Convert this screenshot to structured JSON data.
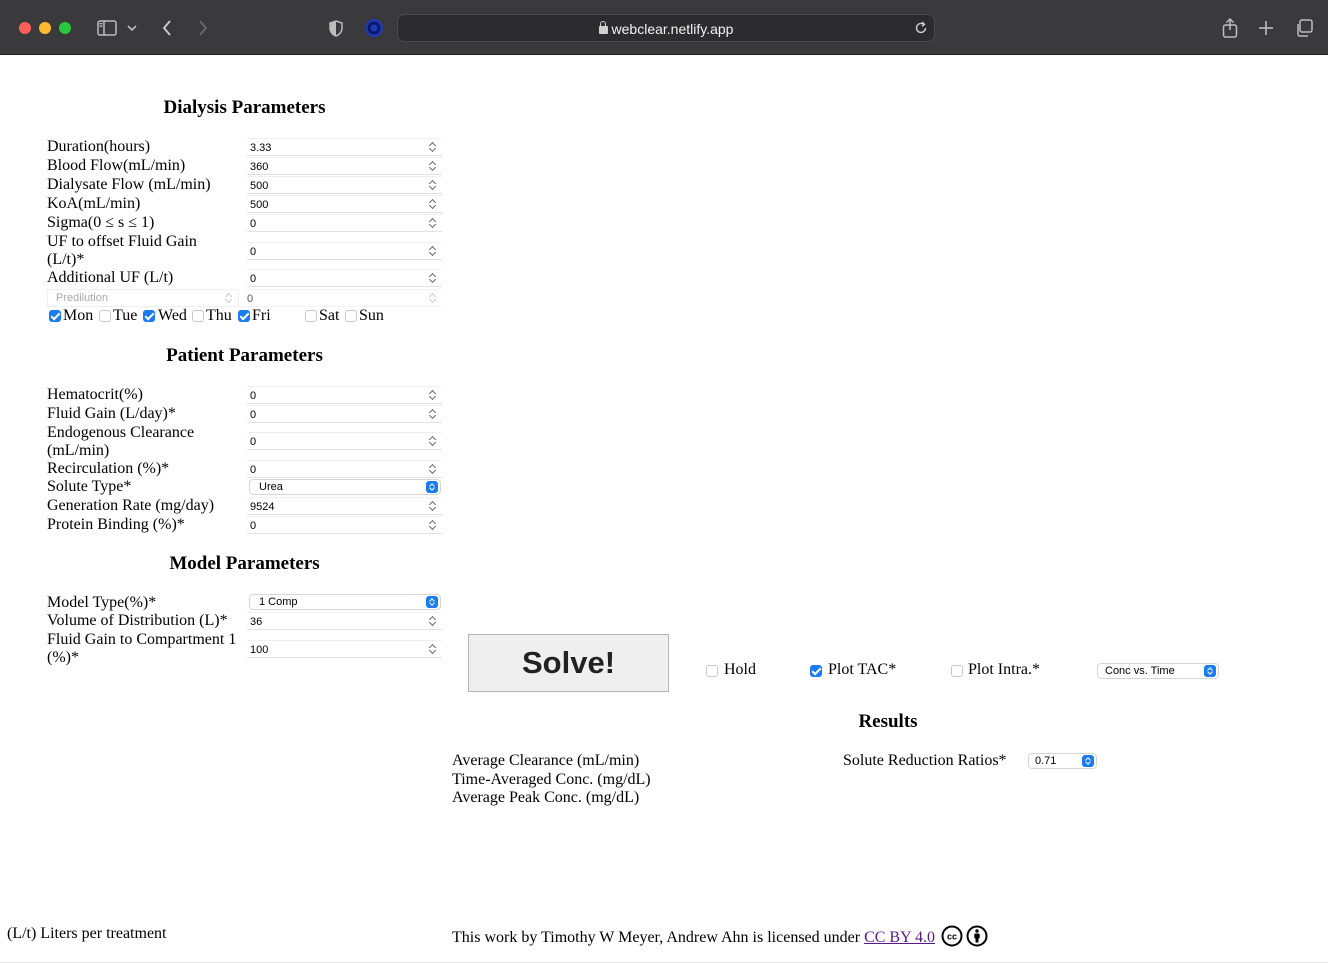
{
  "browser": {
    "url": "webclear.netlify.app"
  },
  "dialysis": {
    "title": "Dialysis Parameters",
    "fields": [
      {
        "label": "Duration(hours)",
        "value": "3.33"
      },
      {
        "label": "Blood Flow(mL/min)",
        "value": "360"
      },
      {
        "label": "Dialysate Flow (mL/min)",
        "value": "500"
      },
      {
        "label": "KoA(mL/min)",
        "value": "500"
      },
      {
        "label": "Sigma(0 ≤ s ≤ 1)",
        "value": "0"
      },
      {
        "label": "UF to offset Fluid Gain (L/t)*",
        "value": "0"
      },
      {
        "label": "Additional UF (L/t)",
        "value": "0"
      }
    ],
    "predilution": {
      "select": "Predilution",
      "value": "0"
    },
    "days": [
      {
        "label": "Mon",
        "checked": true
      },
      {
        "label": "Tue",
        "checked": false
      },
      {
        "label": "Wed",
        "checked": true
      },
      {
        "label": "Thu",
        "checked": false
      },
      {
        "label": "Fri",
        "checked": true
      },
      {
        "label": "Sat",
        "checked": false
      },
      {
        "label": "Sun",
        "checked": false
      }
    ]
  },
  "patient": {
    "title": "Patient Parameters",
    "fields": [
      {
        "label": "Hematocrit(%)",
        "value": "0"
      },
      {
        "label": "Fluid Gain (L/day)*",
        "value": "0"
      },
      {
        "label": "Endogenous Clearance (mL/min)",
        "value": "0"
      },
      {
        "label": "Recirculation (%)*",
        "value": "0"
      },
      {
        "label": "Solute Type*",
        "value": "Urea"
      },
      {
        "label": "Generation Rate (mg/day)",
        "value": "9524"
      },
      {
        "label": "Protein Binding (%)*",
        "value": "0"
      }
    ]
  },
  "model": {
    "title": "Model Parameters",
    "fields": [
      {
        "label": "Model Type(%)*",
        "value": "1 Comp"
      },
      {
        "label": "Volume of Distribution (L)*",
        "value": "36"
      },
      {
        "label": "Fluid Gain to Compartment 1 (%)*",
        "value": "100"
      }
    ]
  },
  "controls": {
    "solve_label": "Solve!",
    "hold": {
      "label": "Hold",
      "checked": false
    },
    "plot_tac": {
      "label": "Plot TAC*",
      "checked": true
    },
    "plot_intra": {
      "label": "Plot Intra.*",
      "checked": false
    },
    "plot_select": "Conc vs. Time"
  },
  "results": {
    "title": "Results",
    "lines": [
      "Average Clearance (mL/min)",
      "Time-Averaged Conc. (mg/dL)",
      "Average Peak Conc. (mg/dL)"
    ],
    "srr_label": "Solute Reduction Ratios*",
    "srr_value": "0.71"
  },
  "footer": {
    "note": "(L/t) Liters per treatment",
    "license_text": "This work by Timothy W Meyer, Andrew Ahn is licensed under",
    "license_link": "CC BY 4.0"
  }
}
